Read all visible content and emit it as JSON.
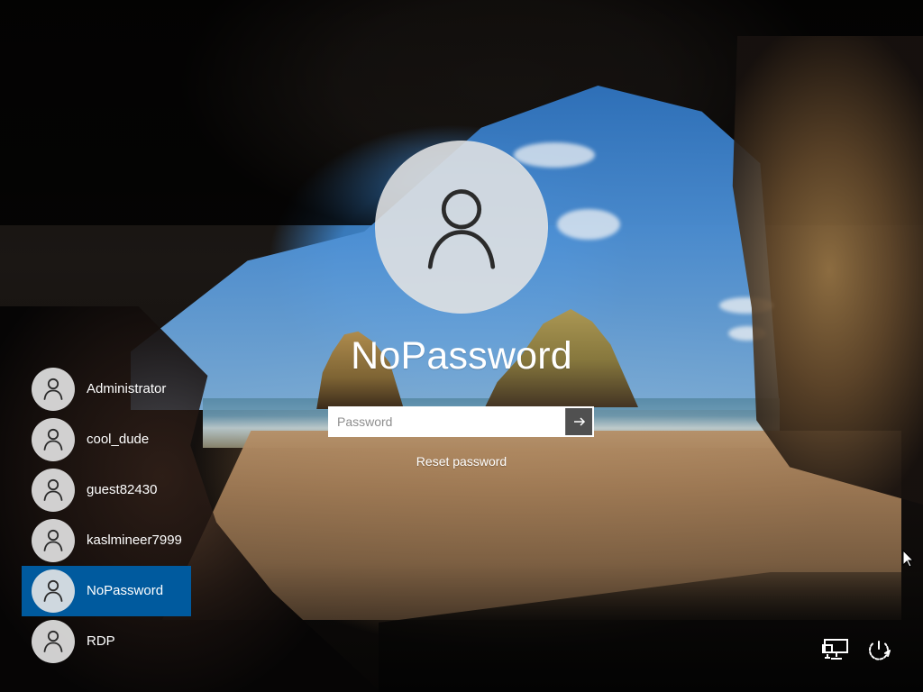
{
  "login": {
    "selected_user": "NoPassword",
    "password_placeholder": "Password",
    "reset_password": "Reset password"
  },
  "users": [
    {
      "name": "Administrator",
      "selected": false
    },
    {
      "name": "cool_dude",
      "selected": false
    },
    {
      "name": "guest82430",
      "selected": false
    },
    {
      "name": "kaslmineer7999",
      "selected": false
    },
    {
      "name": "NoPassword",
      "selected": true
    },
    {
      "name": "RDP",
      "selected": false
    }
  ],
  "icons": {
    "user": "user-icon",
    "submit": "arrow-right-icon",
    "network": "network-icon",
    "power": "power-icon",
    "cursor": "mouse-pointer-icon"
  },
  "colors": {
    "selected_user_background": "#005a9e",
    "text": "#ffffff",
    "avatar_fill": "#e2e2e2",
    "avatar_glyph": "#2b2b2b",
    "submit_background": "#505050"
  }
}
